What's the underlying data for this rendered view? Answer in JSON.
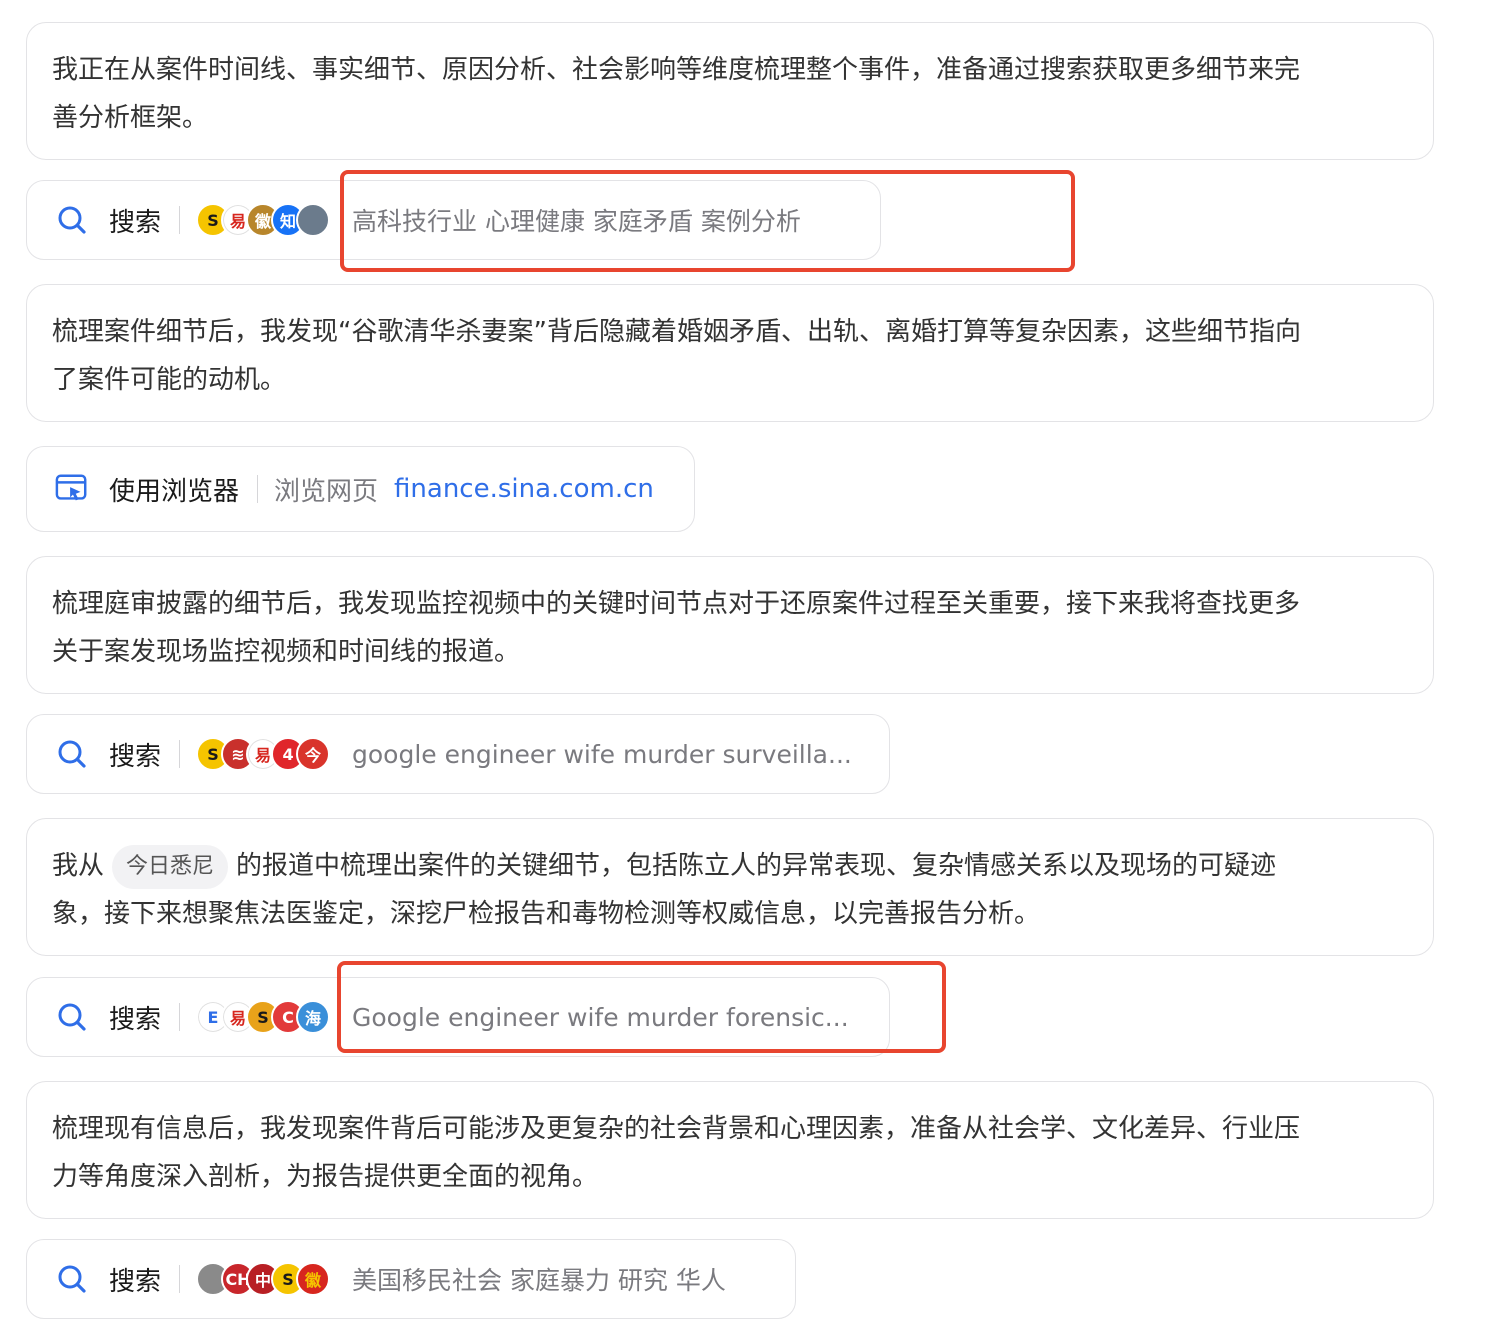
{
  "cards": [
    {
      "lines": [
        "我正在从案件时间线、事实细节、原因分析、社会影响等维度梳理整个事件，准备通过搜索获取更多细节来完",
        "善分析框架。"
      ]
    },
    {
      "lines": [
        "梳理案件细节后，我发现“谷歌清华杀妻案”背后隐藏着婚姻矛盾、出轨、离婚打算等复杂因素，这些细节指向",
        "了案件可能的动机。"
      ]
    },
    {
      "lines": [
        "梳理庭审披露的细节后，我发现监控视频中的关键时间节点对于还原案件过程至关重要，接下来我将查找更多",
        "关于案发现场监控视频和时间线的报道。"
      ]
    },
    {
      "line1_before": "我从",
      "chip": "今日悉尼",
      "line1_after": "的报道中梳理出案件的关键细节，包括陈立人的异常表现、复杂情感关系以及现场的可疑迹",
      "line2": "象，接下来想聚焦法医鉴定，深挖尸检报告和毒物检测等权威信息，以完善报告分析。"
    },
    {
      "lines": [
        "梳理现有信息后，我发现案件背后可能涉及更复杂的社会背景和心理因素，准备从社会学、文化差异、行业压",
        "力等角度深入剖析，为报告提供更全面的视角。"
      ]
    }
  ],
  "searches": [
    {
      "action": "搜索",
      "query": "高科技行业 心理健康 家庭矛盾 案例分析",
      "favicons": [
        {
          "name": "sohu-favicon-icon",
          "glyph": "S",
          "bg": "#f5c400",
          "fg": "#1a1a1a"
        },
        {
          "name": "yi-favicon-icon",
          "glyph": "易",
          "bg": "#ffffff",
          "fg": "#d7261e"
        },
        {
          "name": "emblem-favicon-icon",
          "glyph": "徽",
          "bg": "#b8862b",
          "fg": "#ffffff"
        },
        {
          "name": "zhihu-favicon-icon",
          "glyph": "知",
          "bg": "#1772f6",
          "fg": "#ffffff"
        },
        {
          "name": "photo-favicon-icon",
          "glyph": "",
          "bg": "#6b7b8c",
          "fg": "#ffffff"
        }
      ]
    },
    {
      "action": "搜索",
      "query": "google engineer wife murder surveilla...",
      "favicons": [
        {
          "name": "sohu-favicon-icon",
          "glyph": "S",
          "bg": "#f5c400",
          "fg": "#1a1a1a"
        },
        {
          "name": "swirl-favicon-icon",
          "glyph": "≋",
          "bg": "#c9302c",
          "fg": "#ffffff"
        },
        {
          "name": "yi-favicon-icon",
          "glyph": "易",
          "bg": "#ffffff",
          "fg": "#d7261e"
        },
        {
          "name": "four-favicon-icon",
          "glyph": "4",
          "bg": "#e0262b",
          "fg": "#ffffff"
        },
        {
          "name": "jin-favicon-icon",
          "glyph": "今",
          "bg": "#d9342b",
          "fg": "#ffffff"
        }
      ]
    },
    {
      "action": "搜索",
      "query": "Google engineer wife murder forensic...",
      "favicons": [
        {
          "name": "e-favicon-icon",
          "glyph": "E",
          "bg": "#ffffff",
          "fg": "#2f6ee8"
        },
        {
          "name": "yi-favicon-icon",
          "glyph": "易",
          "bg": "#ffffff",
          "fg": "#d7261e"
        },
        {
          "name": "s-gold-favicon-icon",
          "glyph": "S",
          "bg": "#e8a21a",
          "fg": "#1a1a1a"
        },
        {
          "name": "c-red-favicon-icon",
          "glyph": "C",
          "bg": "#e23a3a",
          "fg": "#ffffff"
        },
        {
          "name": "hai-favicon-icon",
          "glyph": "海",
          "bg": "#3a8fd9",
          "fg": "#ffffff"
        }
      ]
    },
    {
      "action": "搜索",
      "query": "美国移民社会 家庭暴力 研究 华人",
      "favicons": [
        {
          "name": "gray-pattern-favicon-icon",
          "glyph": "",
          "bg": "#8a8a8a",
          "fg": "#ffffff"
        },
        {
          "name": "ch-favicon-icon",
          "glyph": "CH",
          "bg": "#c8262b",
          "fg": "#ffffff"
        },
        {
          "name": "zhongxin-favicon-icon",
          "glyph": "中",
          "bg": "#b81f24",
          "fg": "#ffffff"
        },
        {
          "name": "sohu-favicon-icon",
          "glyph": "S",
          "bg": "#f5c400",
          "fg": "#1a1a1a"
        },
        {
          "name": "emblem-favicon-icon",
          "glyph": "徽",
          "bg": "#d7261e",
          "fg": "#f5c400"
        }
      ]
    }
  ],
  "browser": {
    "action": "使用浏览器",
    "sub": "浏览网页",
    "domain": "finance.sina.com.cn"
  },
  "colors": {
    "highlight": "#e8452f",
    "search_icon": "#2f6ee8",
    "browser_icon": "#2f6ee8"
  }
}
